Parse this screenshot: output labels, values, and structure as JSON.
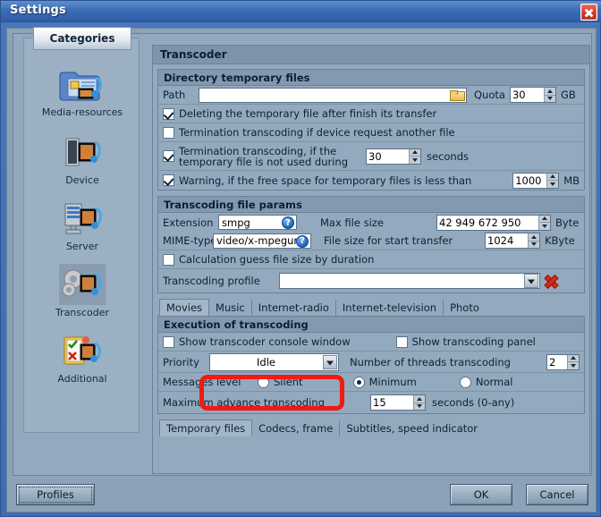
{
  "window": {
    "title": "Settings",
    "close_icon": "close-icon"
  },
  "sidebar": {
    "header": "Categories",
    "items": [
      {
        "label": "Media-resources",
        "icon": "folder-media-icon",
        "selected": false
      },
      {
        "label": "Device",
        "icon": "device-icon",
        "selected": false
      },
      {
        "label": "Server",
        "icon": "server-icon",
        "selected": false
      },
      {
        "label": "Transcoder",
        "icon": "gears-media-icon",
        "selected": true
      },
      {
        "label": "Additional",
        "icon": "clipboard-icon",
        "selected": false
      }
    ]
  },
  "content": {
    "header": "Transcoder",
    "directory_group": {
      "title": "Directory temporary files",
      "path_label": "Path",
      "path_value": "",
      "path_placeholder": "",
      "browse_icon": "folder-open-icon",
      "quota_label": "Quota",
      "quota_value": "30",
      "quota_unit": "GB",
      "checkboxes": [
        {
          "label": "Deleting the temporary file after finish its transfer",
          "checked": true
        },
        {
          "label": "Termination transcoding if device request another file",
          "checked": false
        }
      ],
      "termination_row": {
        "label": "Termination transcoding, if the temporary file is not used during",
        "checked": true,
        "value": "30",
        "unit": "seconds"
      },
      "warning_row": {
        "label": "Warning, if the free space for temporary files is less than",
        "checked": true,
        "value": "1000",
        "unit": "MB"
      }
    },
    "file_params_group": {
      "title": "Transcoding file params",
      "extension_label": "Extension",
      "extension_value": "smpg",
      "extension_help_icon": "help-icon",
      "mime_label": "MIME-type",
      "mime_value": "video/x-mpegurl",
      "mime_help_icon": "help-icon",
      "max_file_size_label": "Max file size",
      "max_file_size_value": "42 949 672 950",
      "max_file_size_unit": "Byte",
      "start_transfer_label": "File size for start transfer",
      "start_transfer_value": "1024",
      "start_transfer_unit": "KByte",
      "guess_checkbox": {
        "label": "Calculation guess file size by duration",
        "checked": false
      },
      "profile_label": "Transcoding profile",
      "profile_value": "",
      "profile_delete_icon": "delete-red-x-icon"
    },
    "media_tabs": [
      {
        "label": "Movies",
        "active": true
      },
      {
        "label": "Music",
        "active": false
      },
      {
        "label": "Internet-radio",
        "active": false
      },
      {
        "label": "Internet-television",
        "active": false
      },
      {
        "label": "Photo",
        "active": false
      }
    ],
    "execution_group": {
      "title": "Execution of transcoding",
      "show_console": {
        "label": "Show transcoder console window",
        "checked": false
      },
      "show_panel": {
        "label": "Show transcoding panel",
        "checked": false
      },
      "priority_label": "Priority",
      "priority_value": "Idle",
      "threads_label": "Number of threads transcoding",
      "threads_value": "2",
      "messages_label": "Messages level",
      "messages_options": [
        {
          "label": "Silent",
          "selected": false
        },
        {
          "label": "Minimum",
          "selected": true
        },
        {
          "label": "Normal",
          "selected": false
        }
      ],
      "advance_label": "Maximum advance transcoding",
      "advance_value": "15",
      "advance_unit": "seconds (0-any)"
    },
    "bottom_tabs": [
      {
        "label": "Temporary files",
        "active": true
      },
      {
        "label": "Codecs, frame",
        "active": false
      },
      {
        "label": "Subtitles, speed indicator",
        "active": false
      }
    ]
  },
  "footer": {
    "profiles_label": "Profiles",
    "ok_label": "OK",
    "cancel_label": "Cancel"
  },
  "annotation": {
    "color": "#f11a14",
    "target": "priority-dropdown"
  }
}
